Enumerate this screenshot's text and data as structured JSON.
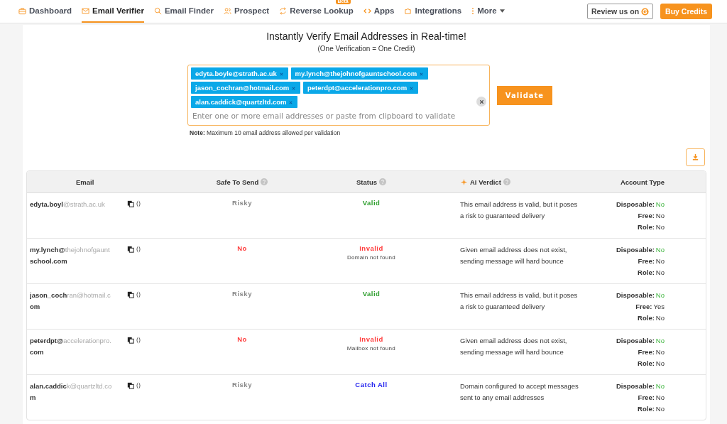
{
  "nav": {
    "items": [
      {
        "label": "Dashboard",
        "selected": false
      },
      {
        "label": "Email Verifier",
        "selected": true
      },
      {
        "label": "Email Finder",
        "selected": false
      },
      {
        "label": "Prospect",
        "selected": false
      },
      {
        "label": "Reverse Lookup",
        "selected": false,
        "badge": "Beta"
      },
      {
        "label": "Apps",
        "selected": false
      },
      {
        "label": "Integrations",
        "selected": false
      },
      {
        "label": "More",
        "selected": false,
        "dropdown": true
      }
    ],
    "review_button": "Review us on",
    "buy_button": "Buy Credits"
  },
  "verifier": {
    "title": "Instantly Verify Email Addresses in Real-time!",
    "subtitle": "(One Verification = One Credit)",
    "chips": [
      "edyta.boyle@strath.ac.uk",
      "my.lynch@thejohnofgauntschool.com",
      "jason_cochran@hotmail.com",
      "peterdpt@accelerationpro.com",
      "alan.caddick@quartzltd.com"
    ],
    "placeholder": "Enter one or more email addresses or paste from clipboard to validate",
    "validate_button": "Validate",
    "note": "**Note:** Maximum 10 email address allowed per validation"
  },
  "table": {
    "columns": [
      "Email",
      "Safe To Send",
      "Status",
      "AI Verdict",
      "Account Type"
    ],
    "rows": [
      {
        "email_lines": [
          [
            {
              "text": "edyta.boyl",
              "faded": false
            },
            {
              "text": "@strath.ac.uk",
              "faded": true
            }
          ]
        ],
        "safe": {
          "text": "Risky",
          "kind": "risky"
        },
        "status": {
          "text": "Valid",
          "kind": "valid"
        },
        "verdict": "This email address is valid, but it poses a risk to guaranteed delivery",
        "account": [
          {
            "label": "Disposable:",
            "value": "No",
            "good": true
          },
          {
            "label": "Free:",
            "value": "No",
            "good": false
          },
          {
            "label": "Role:",
            "value": "No",
            "good": false
          }
        ]
      },
      {
        "email_lines": [
          [
            {
              "text": "my.lynch@",
              "faded": false
            },
            {
              "text": "thejohnofgaunt",
              "faded": true
            }
          ],
          [
            {
              "text": "school.com",
              "faded": false
            }
          ]
        ],
        "safe": {
          "text": "No",
          "kind": "no"
        },
        "status": {
          "text": "Invalid",
          "kind": "invalid",
          "detail": "Domain not found"
        },
        "verdict": "Given email address does not exist, sending message will hard bounce",
        "account": [
          {
            "label": "Disposable:",
            "value": "No",
            "good": true
          },
          {
            "label": "Free:",
            "value": "No",
            "good": false
          },
          {
            "label": "Role:",
            "value": "No",
            "good": false
          }
        ]
      },
      {
        "email_lines": [
          [
            {
              "text": "jason_coch",
              "faded": false
            },
            {
              "text": "ran@hotmail.c",
              "faded": true
            }
          ],
          [
            {
              "text": "om",
              "faded": false
            }
          ]
        ],
        "safe": {
          "text": "Risky",
          "kind": "risky"
        },
        "status": {
          "text": "Valid",
          "kind": "valid"
        },
        "verdict": "This email address is valid, but it poses a risk to guaranteed delivery",
        "account": [
          {
            "label": "Disposable:",
            "value": "No",
            "good": true
          },
          {
            "label": "Free:",
            "value": "Yes",
            "good": false
          },
          {
            "label": "Role:",
            "value": "No",
            "good": false
          }
        ]
      },
      {
        "email_lines": [
          [
            {
              "text": "peterdpt@",
              "faded": false
            },
            {
              "text": "accelerationpro.",
              "faded": true
            }
          ],
          [
            {
              "text": "com",
              "faded": false
            }
          ]
        ],
        "safe": {
          "text": "No",
          "kind": "no"
        },
        "status": {
          "text": "Invalid",
          "kind": "invalid",
          "detail": "Mailbox not found"
        },
        "verdict": "Given email address does not exist, sending message will hard bounce",
        "account": [
          {
            "label": "Disposable:",
            "value": "No",
            "good": true
          },
          {
            "label": "Free:",
            "value": "No",
            "good": false
          },
          {
            "label": "Role:",
            "value": "No",
            "good": false
          }
        ]
      },
      {
        "email_lines": [
          [
            {
              "text": "alan.caddic",
              "faded": false
            },
            {
              "text": "k@quartzltd.co",
              "faded": true
            }
          ],
          [
            {
              "text": "m",
              "faded": false
            }
          ]
        ],
        "safe": {
          "text": "Risky",
          "kind": "risky"
        },
        "status": {
          "text": "Catch All",
          "kind": "catchall"
        },
        "verdict": "Domain configured to accept messages sent to any email addresses",
        "account": [
          {
            "label": "Disposable:",
            "value": "No",
            "good": true
          },
          {
            "label": "Free:",
            "value": "No",
            "good": false
          },
          {
            "label": "Role:",
            "value": "No",
            "good": false
          }
        ]
      }
    ]
  }
}
